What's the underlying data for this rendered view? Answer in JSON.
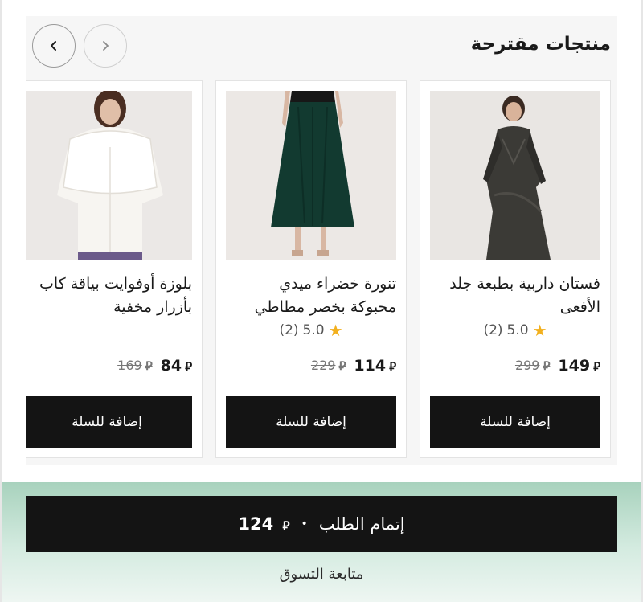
{
  "section": {
    "title": "منتجات مقترحة"
  },
  "nav": {
    "prev_icon": "chevron-right-icon",
    "next_icon": "chevron-left-icon"
  },
  "products": [
    {
      "name_line1": "فستان داربية بطبعة جلد",
      "name_line2": "الأفعى",
      "rating": "5.0",
      "reviews": "(2)",
      "price": "149",
      "old_price": "299",
      "currency_symbol": "⃁",
      "add_label": "إضافة للسلة"
    },
    {
      "name_line1": "تنورة خضراء ميدي",
      "name_line2": "محبوكة بخصر مطاطي",
      "rating": "5.0",
      "reviews": "(2)",
      "price": "114",
      "old_price": "229",
      "currency_symbol": "⃁",
      "add_label": "إضافة للسلة"
    },
    {
      "name_line1": "بلوزة أوفوايت بياقة كاب",
      "name_line2": "بأزرار مخفية",
      "price": "84",
      "old_price": "169",
      "currency_symbol": "⃁",
      "add_label": "إضافة للسلة"
    }
  ],
  "footer": {
    "checkout_label": "إتمام الطلب",
    "separator": "•",
    "total": "124",
    "currency_symbol": "⃁",
    "continue_label": "متابعة التسوق"
  },
  "colors": {
    "button_bg": "#141414",
    "star": "#f2b01e",
    "footer_gradient_top": "#a8d2bd"
  }
}
